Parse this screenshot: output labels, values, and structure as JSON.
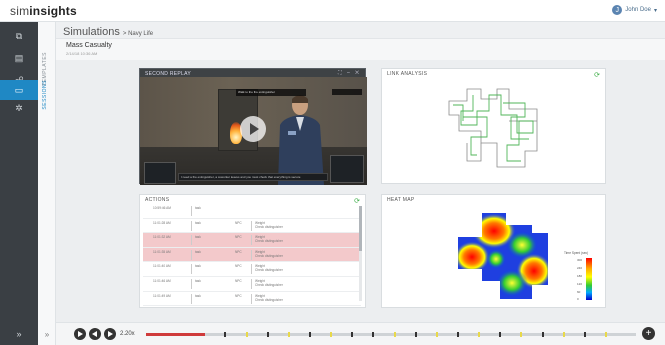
{
  "app": {
    "logo_light": "sim",
    "logo_bold": "insights",
    "user_name": "John Doe",
    "user_initial": "J"
  },
  "sidebar": {
    "items": [
      {
        "icon": "clipboard-icon",
        "glyph": "⧉"
      },
      {
        "icon": "document-icon",
        "glyph": "▤"
      },
      {
        "icon": "users-icon",
        "glyph": "☍"
      },
      {
        "icon": "sessions-icon",
        "glyph": "▭",
        "active": true
      },
      {
        "icon": "gear-icon",
        "glyph": "✲"
      }
    ],
    "expand_glyph": "»"
  },
  "strip": {
    "templates_label": "TEMPLATES",
    "sessions_label": "SESSIONS",
    "expand_glyph": "»"
  },
  "breadcrumb": {
    "main": "Simulations",
    "sub": "> Navy Life"
  },
  "session": {
    "title": "Mass Casualty",
    "date": "2/14/18 10:36 AM"
  },
  "replay": {
    "title": "SECOND REPLAY",
    "controls": "⛶ ‒ ✕",
    "hint": "Walk to the fire extinguisher",
    "subtitle": "I need a fire extinguisher, a coworker leaves and you must check that everything is secure"
  },
  "link_analysis": {
    "title": "LINK ANALYSIS",
    "action_icon": "refresh-icon"
  },
  "actions": {
    "title": "ACTIONS",
    "rows": [
      {
        "time": "10:59:46 AM",
        "event": "Task Started",
        "who": "task",
        "where": "Port Start Point",
        "cat": "",
        "zone": "",
        "desc": "",
        "highlight": false
      },
      {
        "time": "11:01:28 AM",
        "event": "Talk-to-NPC",
        "who": "task",
        "where": "Port Start Point",
        "cat": "NPC",
        "zone": "NPC2",
        "desc": "Weight\nCheck distinguisher",
        "highlight": false
      },
      {
        "time": "11:01:32 AM",
        "event": "Talk-to-NPC",
        "who": "task",
        "where": "Port Start Point",
        "cat": "NPC",
        "zone": "NPC2",
        "desc": "Weight\nCheck distinguisher",
        "highlight": true
      },
      {
        "time": "11:01:35 AM",
        "event": "Talk-to-NPC",
        "who": "task",
        "where": "Port Start Point",
        "cat": "NPC",
        "zone": "NPC2",
        "desc": "Weight\nCheck distinguisher",
        "highlight": true
      },
      {
        "time": "11:01:40 AM",
        "event": "Talk-to-NPC",
        "who": "task",
        "where": "Port Start Point",
        "cat": "NPC",
        "zone": "NPC2",
        "desc": "Weight\nCheck distinguisher",
        "highlight": false
      },
      {
        "time": "11:01:46 AM",
        "event": "Talk-to-NPC",
        "who": "task",
        "where": "Port Start Point",
        "cat": "NPC",
        "zone": "NPC2",
        "desc": "Weight\nCheck distinguisher",
        "highlight": false
      },
      {
        "time": "11:01:49 AM",
        "event": "Talk-to-NPC",
        "who": "task",
        "where": "Port Start Point",
        "cat": "NPC",
        "zone": "NPC2",
        "desc": "Weight\nCheck distinguisher",
        "highlight": false
      }
    ],
    "scroll_position": 0.0
  },
  "heat_map": {
    "title": "HEAT MAP",
    "legend_title": "Time Spent (sec)",
    "legend_ticks": [
      "300",
      "240",
      "180",
      "120",
      "60",
      "0"
    ],
    "colors": [
      "#ff0000",
      "#ffaa00",
      "#ffff00",
      "#33cc33",
      "#00aaff",
      "#0000cc"
    ]
  },
  "playback": {
    "speed": "2.20x",
    "progress": 0.12,
    "marker_colors": {
      "red": "#cf3b3b",
      "yellow": "#e8d94a",
      "dark": "#333333"
    },
    "add_glyph": "+"
  },
  "colors": {
    "accent": "#1f88c4",
    "link_path": "#3fae49",
    "highlight_row": "#f3c9cb",
    "sidebar": "#3a3f44"
  }
}
